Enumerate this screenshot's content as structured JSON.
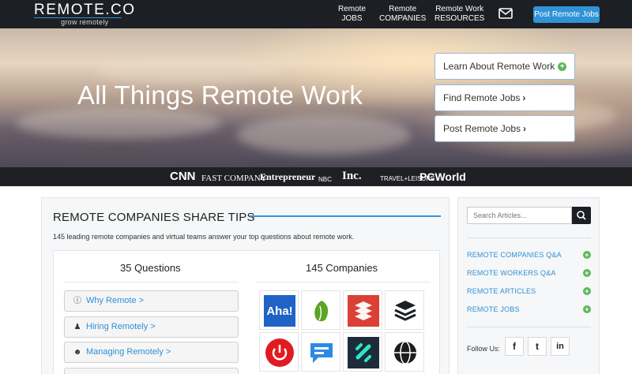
{
  "header": {
    "logo": "REMOTE.CO",
    "tagline": "grow remotely",
    "nav": [
      {
        "line1": "Remote",
        "line2": "JOBS"
      },
      {
        "line1": "Remote",
        "line2": "COMPANIES"
      },
      {
        "line1": "Remote Work",
        "line2": "RESOURCES"
      }
    ],
    "mail_icon": "envelope-icon",
    "post_button": "Post Remote Jobs",
    "accent_color": "#3093d6"
  },
  "hero": {
    "title": "All Things Remote Work",
    "buttons": [
      {
        "label": "Learn About Remote Work",
        "icon": "plus-circle-icon"
      },
      {
        "label": "Find Remote Jobs",
        "icon": "chevron-right-icon"
      },
      {
        "label": "Post Remote Jobs",
        "icon": "chevron-right-icon"
      }
    ]
  },
  "press": [
    "CNN",
    "FAST COMPANY",
    "Entrepreneur",
    "NBC",
    "Inc.",
    "TRAVEL+LEISURE",
    "PCWorld"
  ],
  "main": {
    "title": "REMOTE COMPANIES SHARE TIPS",
    "description": "145 leading remote companies and virtual teams answer your top questions about remote work.",
    "questions_header": "35 Questions",
    "companies_header": "145 Companies",
    "questions": [
      {
        "label": "Why Remote >",
        "icon": "info-circle-icon"
      },
      {
        "label": "Hiring Remotely >",
        "icon": "person-icon"
      },
      {
        "label": "Managing Remotely >",
        "icon": "users-icon"
      }
    ],
    "companies": [
      {
        "icon": "aha-logo",
        "text": "Aha!",
        "color": "#1f63c6"
      },
      {
        "icon": "evernote-leaf-logo",
        "text": "",
        "color": "#5ba525"
      },
      {
        "icon": "todoist-logo",
        "text": "",
        "color": "#db4035"
      },
      {
        "icon": "buffer-stack-logo",
        "text": "",
        "color": "#1c1f24"
      },
      {
        "icon": "toggl-power-logo",
        "text": "",
        "color": "#e01b22"
      },
      {
        "icon": "chat-bubble-logo",
        "text": "",
        "color": "#2d8ae0"
      },
      {
        "icon": "slash-logo",
        "text": "",
        "color": "#1e2b3a"
      },
      {
        "icon": "globe-logo",
        "text": "",
        "color": "#1c1c1c"
      }
    ]
  },
  "sidebar": {
    "search_placeholder": "Search Articles...",
    "search_icon": "search-icon",
    "links": [
      "REMOTE COMPANIES Q&A",
      "REMOTE WORKERS Q&A",
      "REMOTE ARTICLES",
      "REMOTE JOBS"
    ],
    "follow_label": "Follow Us:",
    "social": [
      {
        "icon": "facebook-icon",
        "glyph": "f"
      },
      {
        "icon": "twitter-icon",
        "glyph": "t"
      },
      {
        "icon": "linkedin-icon",
        "glyph": "in"
      }
    ]
  }
}
